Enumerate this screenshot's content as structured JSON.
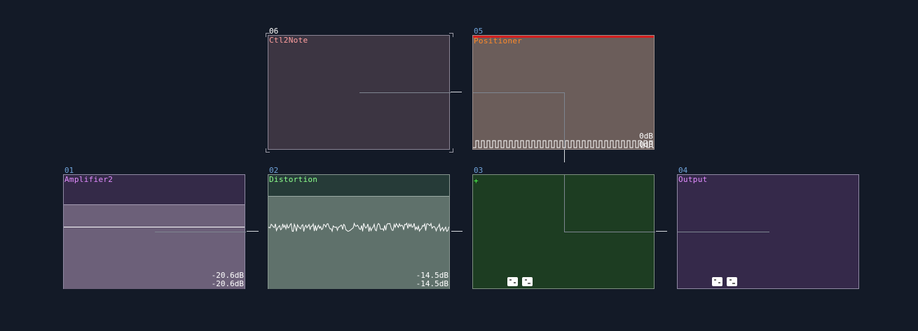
{
  "nodes": {
    "ctl2note": {
      "index": "06",
      "name": "Ctl2Note"
    },
    "positioner": {
      "index": "05",
      "name": "Positioner",
      "db_top": "0dB",
      "db_bottom": "0dB"
    },
    "amplifier2": {
      "index": "01",
      "name": "Amplifier2",
      "db_top": "-20.6dB",
      "db_bottom": "-20.6dB"
    },
    "distortion": {
      "index": "02",
      "name": "Distortion",
      "db_top": "-14.5dB",
      "db_bottom": "-14.5dB"
    },
    "mixer": {
      "index": "03",
      "name": "+"
    },
    "output": {
      "index": "04",
      "name": "Output"
    }
  },
  "colors": {
    "background": "#131a27",
    "ctl2note_name": "#ff9f9f",
    "positioner_name": "#ff8a2a",
    "amplifier_name": "#e28cff",
    "distortion_name": "#8cff8c",
    "mixer_name": "#4cff4c",
    "output_name": "#e28cff",
    "index": "#6fa2d8"
  }
}
